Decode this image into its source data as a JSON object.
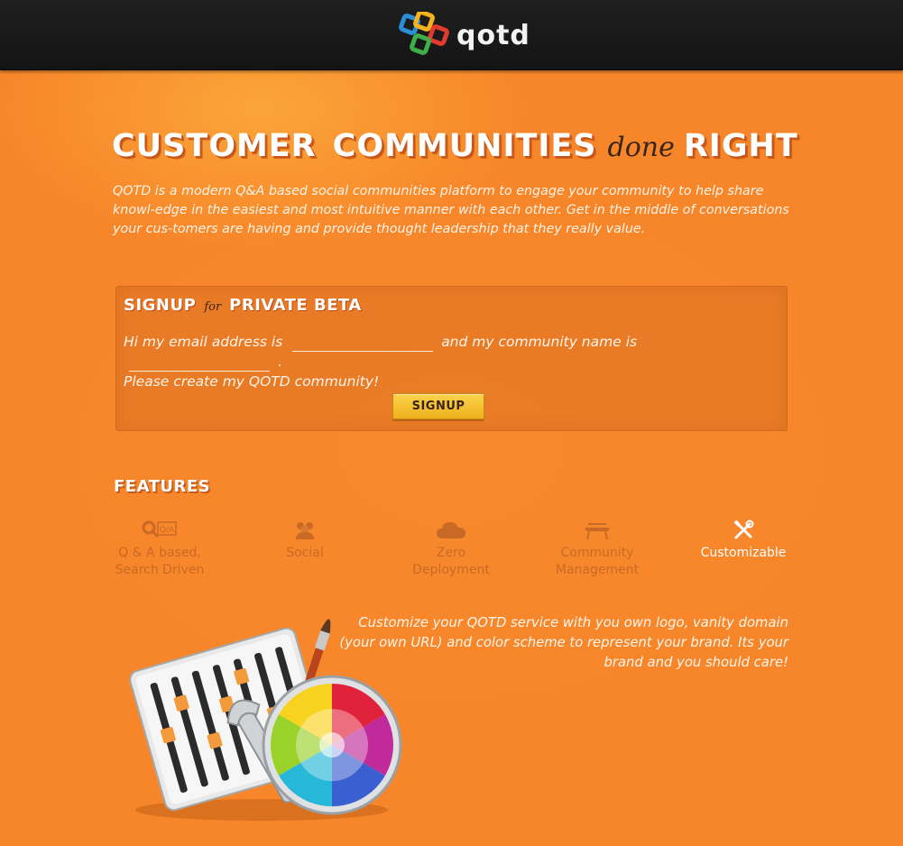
{
  "header": {
    "logo_text": "qotd",
    "logo_colors": [
      "#2a8fd6",
      "#f3b21f",
      "#e23b2e",
      "#3fae49"
    ]
  },
  "hero": {
    "headline_word1": "CUSTOMER",
    "headline_word2": "COMMUNITIES",
    "headline_script": "done",
    "headline_word3": "RIGHT",
    "intro": "QOTD is a modern Q&A based social communities platform to engage your community to help share knowl-edge in the easiest and most intuitive manner with each other. Get in the middle of conversations your cus-tomers are having and provide thought leadership that they really value."
  },
  "signup": {
    "title_part1": "SIGNUP",
    "title_script": "for",
    "title_part2": "PRIVATE BETA",
    "sentence_part1": "Hi my email address is",
    "sentence_part2": "and my community name is",
    "sentence_end": ".",
    "sentence_line2": "Please create my QOTD community!",
    "email_value": "",
    "community_value": "",
    "button_label": "SIGNUP"
  },
  "features": {
    "title": "FEATURES",
    "items": [
      {
        "line1": "Q & A based,",
        "line2": "Search Driven",
        "icon": "qa-search-icon"
      },
      {
        "line1": "Social",
        "line2": "",
        "icon": "people-icon"
      },
      {
        "line1": "Zero",
        "line2": "Deployment",
        "icon": "cloud-icon"
      },
      {
        "line1": "Community",
        "line2": "Management",
        "icon": "podium-icon"
      },
      {
        "line1": "Customizable",
        "line2": "",
        "icon": "tools-icon"
      }
    ],
    "active_index": 4,
    "description": "Customize your QOTD service with you own logo, vanity domain (your own URL) and color scheme to represent your brand. Its your brand and you should care!"
  },
  "colors": {
    "background": "#f7862a",
    "topbar": "#1a1a1a",
    "button": "#f5c232",
    "inactive_feature": "#c86a26"
  }
}
